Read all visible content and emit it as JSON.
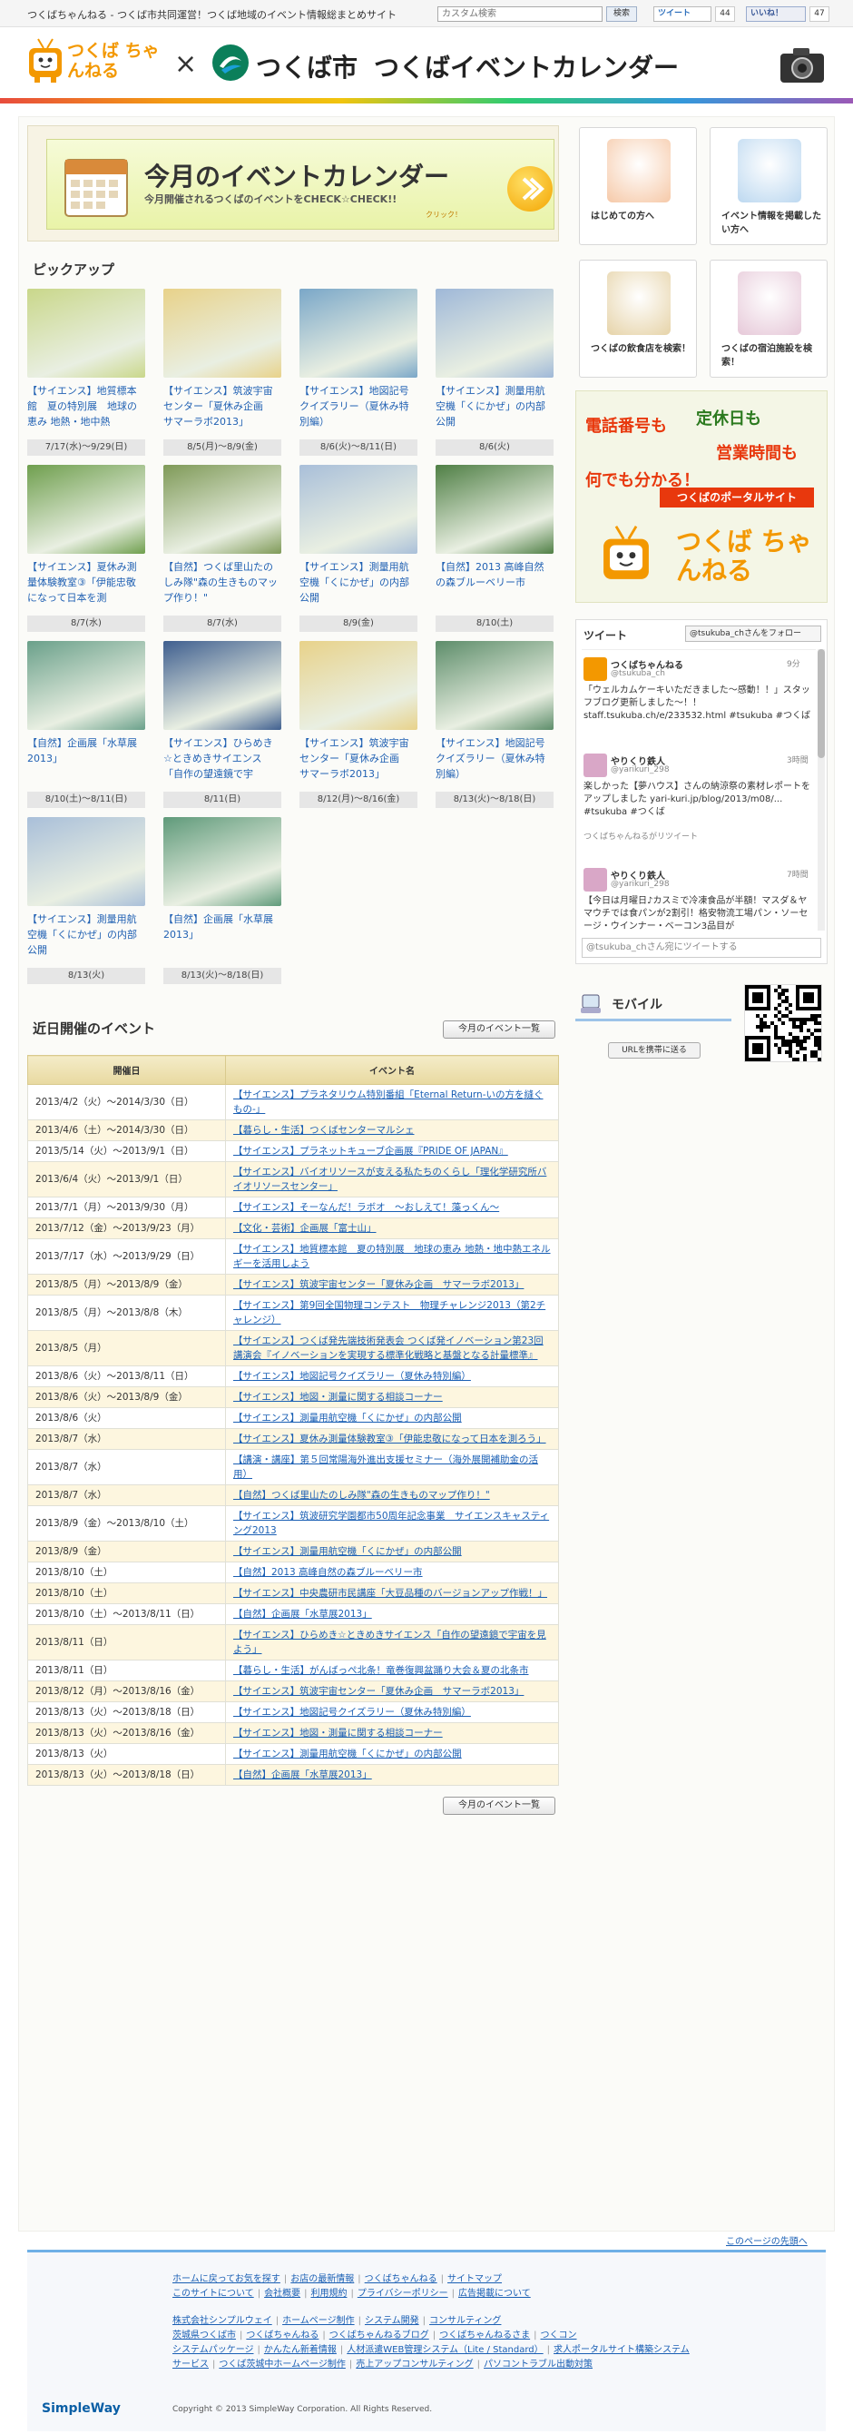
{
  "topbar": {
    "tagline": "つくばちゃんねる - つくば市共同運営！つくば地域のイベント情報総まとめサイト",
    "search_placeholder": "カスタム検索",
    "search_button": "検索",
    "tweet_label": "ツイート",
    "tweet_count": "44",
    "like_label": "いいね！",
    "like_count": "47"
  },
  "header": {
    "logo_text": "つくば ちゃんねる",
    "cross": "×",
    "city_name": "つくば市",
    "calendar_title": "つくばイベントカレンダー"
  },
  "banner": {
    "title": "今月のイベントカレンダー",
    "subtitle": "今月開催されるつくばのイベントをCHECK☆CHECK!!",
    "click": "クリック！"
  },
  "pickup": {
    "title": "ピックアップ",
    "items": [
      {
        "title": "【サイエンス】地質標本館　夏の特別展　地球の恵み 地熱・地中熱",
        "date": "7/17(水)～9/29(日)",
        "color": "#c9d78a"
      },
      {
        "title": "【サイエンス】筑波宇宙センター「夏休み企画　サマーラボ2013」",
        "date": "8/5(月)～8/9(金)",
        "color": "#e8d28a"
      },
      {
        "title": "【サイエンス】地図記号クイズラリー（夏休み特別編）",
        "date": "8/6(火)～8/11(日)",
        "color": "#7aa7c8"
      },
      {
        "title": "【サイエンス】測量用航空機「くにかぜ」の内部公開",
        "date": "8/6(火)",
        "color": "#9fb8d8"
      },
      {
        "title": "【サイエンス】夏休み測量体験教室③「伊能忠敬になって日本を測",
        "date": "8/7(水)",
        "color": "#6f9f4e"
      },
      {
        "title": "【自然】つくば里山たのしみ隊\"森の生きものマップ作り！\"",
        "date": "8/7(水)",
        "color": "#7f9a58"
      },
      {
        "title": "【サイエンス】測量用航空機「くにかぜ」の内部公開",
        "date": "8/9(金)",
        "color": "#a9bfd9"
      },
      {
        "title": "【自然】2013 高峰自然の森ブルーベリー市",
        "date": "8/10(土)",
        "color": "#4f7f45"
      },
      {
        "title": "【自然】企画展「水草展2013」",
        "date": "8/10(土)～8/11(日)",
        "color": "#6aa08a"
      },
      {
        "title": "【サイエンス】ひらめき☆ときめきサイエンス「自作の望遠鏡で宇",
        "date": "8/11(日)",
        "color": "#3f5f8f"
      },
      {
        "title": "【サイエンス】筑波宇宙センター「夏休み企画　サマーラボ2013」",
        "date": "8/12(月)～8/16(金)",
        "color": "#e8d28a"
      },
      {
        "title": "【サイエンス】地図記号クイズラリー（夏休み特別編）",
        "date": "8/13(火)～8/18(日)",
        "color": "#5d8d6a"
      },
      {
        "title": "【サイエンス】測量用航空機「くにかぜ」の内部公開",
        "date": "8/13(火)",
        "color": "#a9bfd9"
      },
      {
        "title": "【自然】企画展「水草展2013」",
        "date": "8/13(火)～8/18(日)",
        "color": "#5f9a7a"
      }
    ]
  },
  "side_tiles": [
    {
      "label": "はじめての方へ",
      "color": "#f6c9a8"
    },
    {
      "label": "イベント情報を掲載したい方へ",
      "color": "#bcd8f0"
    },
    {
      "label": "つくばの飲食店を検索！",
      "color": "#e6d3a8"
    },
    {
      "label": "つくばの宿泊施設を検索！",
      "color": "#e6c8d8"
    }
  ],
  "portal": {
    "phone": "電話番号も",
    "holiday": "定休日も",
    "hours": "営業時間も",
    "anything": "何でも分かる！",
    "portal_site": "つくばのポータルサイト",
    "name": "つくば ちゃんねる"
  },
  "twitter": {
    "header": "ツイート",
    "follow": "@tsukuba_chさんをフォロー",
    "tweets": [
      {
        "name": "つくばちゃんねる",
        "handle": "@tsukuba_ch",
        "time": "9分",
        "body": "「ウェルカムケーキいただきました〜感動！！」スタッフブログ更新しました〜！！ staff.tsukuba.ch/e/233532.html #tsukuba #つくば",
        "sub": ""
      },
      {
        "name": "やりくり鉄人",
        "handle": "@yarikuri_298",
        "time": "3時間",
        "body": "楽しかった【夢ハウス】さんの納涼祭の素材レポートをアップしました yari-kuri.jp/blog/2013/m08/... #tsukuba #つくば",
        "sub": "つくばちゃんねるがリツイート"
      },
      {
        "name": "やりくり鉄人",
        "handle": "@yarikuri_298",
        "time": "7時間",
        "body": "【今日は月曜日♪カスミで冷凍食品が半額！マスダ＆ヤマウチでは食パンが2割引！格安物流工場パン・ソーセージ・ウインナー・ベーコン3品目が",
        "sub": ""
      }
    ],
    "compose_placeholder": "@tsukuba_chさん宛にツイートする"
  },
  "mobile": {
    "label": "モバイル",
    "button": "URLを携帯に送る"
  },
  "upcoming": {
    "title": "近日開催のイベント",
    "month_button": "今月のイベント一覧",
    "col_date": "開催日",
    "col_name": "イベント名",
    "rows": [
      {
        "date": "2013/4/2（火）～2014/3/30（日）",
        "name": "【サイエンス】プラネタリウム特別番組「Eternal Return-いの方を縫ぐもの-」"
      },
      {
        "date": "2013/4/6（土）～2014/3/30（日）",
        "name": "【暮らし・生活】つくばセンターマルシェ"
      },
      {
        "date": "2013/5/14（火）～2013/9/1（日）",
        "name": "【サイエンス】プラネットキューブ企画展『PRIDE OF JAPAN』"
      },
      {
        "date": "2013/6/4（火）～2013/9/1（日）",
        "name": "【サイエンス】バイオリソースが支える私たちのくらし「理化学研究所バイオリソースセンター」"
      },
      {
        "date": "2013/7/1（月）～2013/9/30（月）",
        "name": "【サイエンス】そーなんだ！ラボオ　～おしえて！藻っくん～"
      },
      {
        "date": "2013/7/12（金）～2013/9/23（月）",
        "name": "【文化・芸術】企画展「富士山」"
      },
      {
        "date": "2013/7/17（水）～2013/9/29（日）",
        "name": "【サイエンス】地質標本館　夏の特別展　地球の恵み 地熱・地中熱エネルギーを活用しよう"
      },
      {
        "date": "2013/8/5（月）～2013/8/9（金）",
        "name": "【サイエンス】筑波宇宙センター「夏休み企画　サマーラボ2013」"
      },
      {
        "date": "2013/8/5（月）～2013/8/8（木）",
        "name": "【サイエンス】第9回全国物理コンテスト　物理チャレンジ2013（第2チャレンジ）"
      },
      {
        "date": "2013/8/5（月）",
        "name": "【サイエンス】つくば発先端技術発表会 つくば発イノベーション第23回講演会『イノベーションを実現する標準化戦略と基盤となる計量標準』"
      },
      {
        "date": "2013/8/6（火）～2013/8/11（日）",
        "name": "【サイエンス】地図記号クイズラリー（夏休み特別編）"
      },
      {
        "date": "2013/8/6（火）～2013/8/9（金）",
        "name": "【サイエンス】地図・測量に関する相談コーナー"
      },
      {
        "date": "2013/8/6（火）",
        "name": "【サイエンス】測量用航空機「くにかぜ」の内部公開"
      },
      {
        "date": "2013/8/7（水）",
        "name": "【サイエンス】夏休み測量体験教室③「伊能忠敬になって日本を測ろう」"
      },
      {
        "date": "2013/8/7（水）",
        "name": "【講演・講座】第５回常陽海外進出支援セミナー（海外展開補助金の活用）"
      },
      {
        "date": "2013/8/7（水）",
        "name": "【自然】つくば里山たのしみ隊\"森の生きものマップ作り！\""
      },
      {
        "date": "2013/8/9（金）～2013/8/10（土）",
        "name": "【サイエンス】筑波研究学園都市50周年記念事業　サイエンスキャスティング2013"
      },
      {
        "date": "2013/8/9（金）",
        "name": "【サイエンス】測量用航空機「くにかぜ」の内部公開"
      },
      {
        "date": "2013/8/10（土）",
        "name": "【自然】2013 高峰自然の森ブルーベリー市"
      },
      {
        "date": "2013/8/10（土）",
        "name": "【サイエンス】中央農研市民講座「大豆品種のバージョンアップ作戦！」"
      },
      {
        "date": "2013/8/10（土）～2013/8/11（日）",
        "name": "【自然】企画展「水草展2013」"
      },
      {
        "date": "2013/8/11（日）",
        "name": "【サイエンス】ひらめき☆ときめきサイエンス「自作の望遠鏡で宇宙を見よう」"
      },
      {
        "date": "2013/8/11（日）",
        "name": "【暮らし・生活】がんばっぺ北条！竜巻復興盆踊り大会＆夏の北条市"
      },
      {
        "date": "2013/8/12（月）～2013/8/16（金）",
        "name": "【サイエンス】筑波宇宙センター「夏休み企画　サマーラボ2013」"
      },
      {
        "date": "2013/8/13（火）～2013/8/18（日）",
        "name": "【サイエンス】地図記号クイズラリー（夏休み特別編）"
      },
      {
        "date": "2013/8/13（火）～2013/8/16（金）",
        "name": "【サイエンス】地図・測量に関する相談コーナー"
      },
      {
        "date": "2013/8/13（火）",
        "name": "【サイエンス】測量用航空機「くにかぜ」の内部公開"
      },
      {
        "date": "2013/8/13（火）～2013/8/18（日）",
        "name": "【自然】企画展「水草展2013」"
      }
    ]
  },
  "page_top": "このページの先頭へ",
  "footer": {
    "rows": [
      [
        "ホームに戻ってお気を探す",
        "お店の最新情報",
        "つくばちゃんねる",
        "サイトマップ"
      ],
      [
        "このサイトについて",
        "会社概要",
        "利用規約",
        "プライバシーポリシー",
        "広告掲載について"
      ],
      [
        "株式会社シンプルウェイ",
        "ホームページ制作",
        "システム開発",
        "コンサルティング"
      ],
      [
        "茨城県つくば市",
        "つくばちゃんねる",
        "つくばちゃんねるブログ",
        "つくばちゃんねるさま",
        "つくコン"
      ],
      [
        "システムパッケージ",
        "かんたん新着情報",
        "人材派遣WEB管理システム（Lite / Standard）",
        "求人ポータルサイト構築システム"
      ],
      [
        "サービス",
        "つくば茨城中ホームページ制作",
        "売上アップコンサルティング",
        "パソコントラブル出動対策"
      ]
    ],
    "brand": "SimpleWay",
    "copyright": "Copyright © 2013 SimpleWay Corporation. All Rights Reserved."
  }
}
